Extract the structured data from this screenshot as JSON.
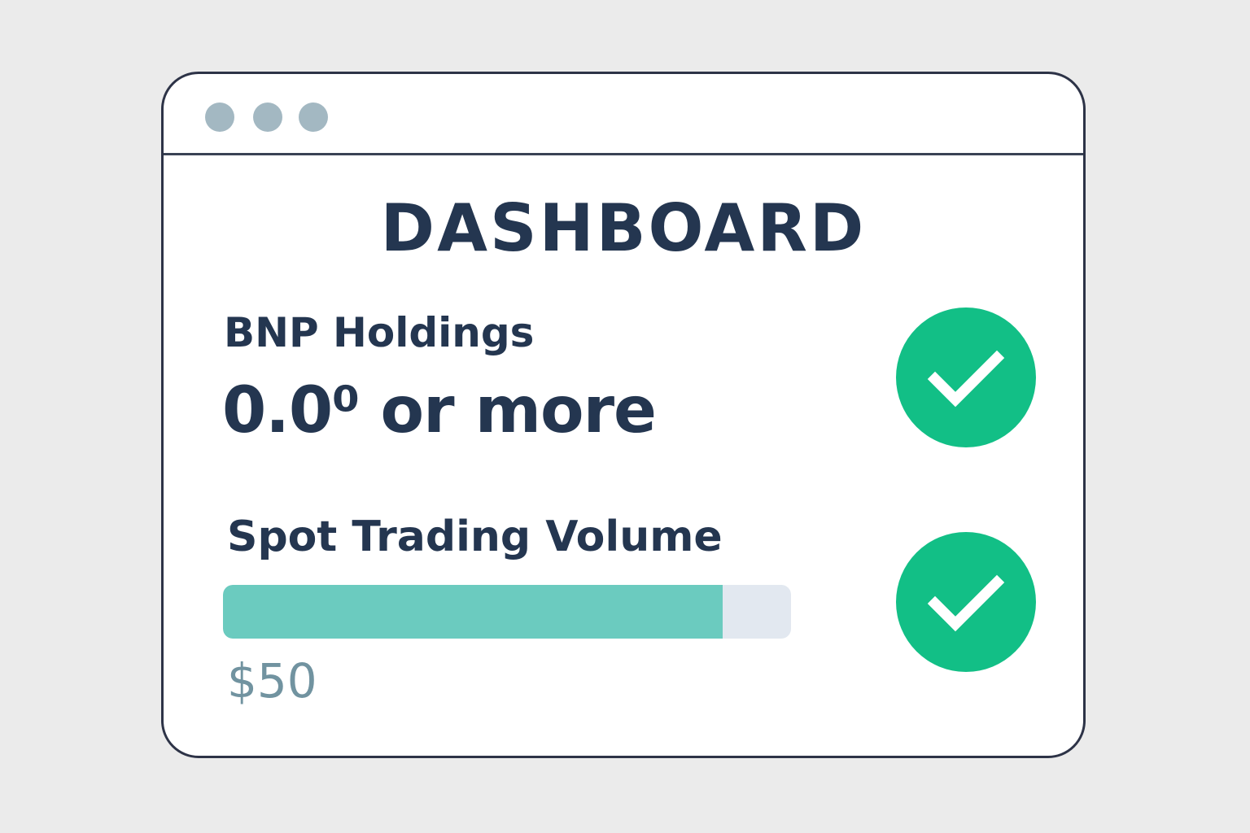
{
  "window": {
    "control_dots": [
      "window-dot-icon",
      "window-dot-icon",
      "window-dot-icon"
    ],
    "dot_color": "#a3b8c2"
  },
  "dashboard": {
    "title": "DASHBOARD",
    "holdings": {
      "label": "BNP Holdings",
      "value": "0.0⁰ or more",
      "status_icon": "checkmark-circle-icon"
    },
    "spot_volume": {
      "label": "Spot Trading Volume",
      "progress_fraction": 0.88,
      "amount": "$50",
      "status_icon": "checkmark-circle-icon"
    }
  },
  "colors": {
    "text_primary": "#243650",
    "success": "#12bf86",
    "progress_fill": "#6bcbbf",
    "progress_track": "#e2e8f0",
    "amount_text": "#7193a0"
  }
}
